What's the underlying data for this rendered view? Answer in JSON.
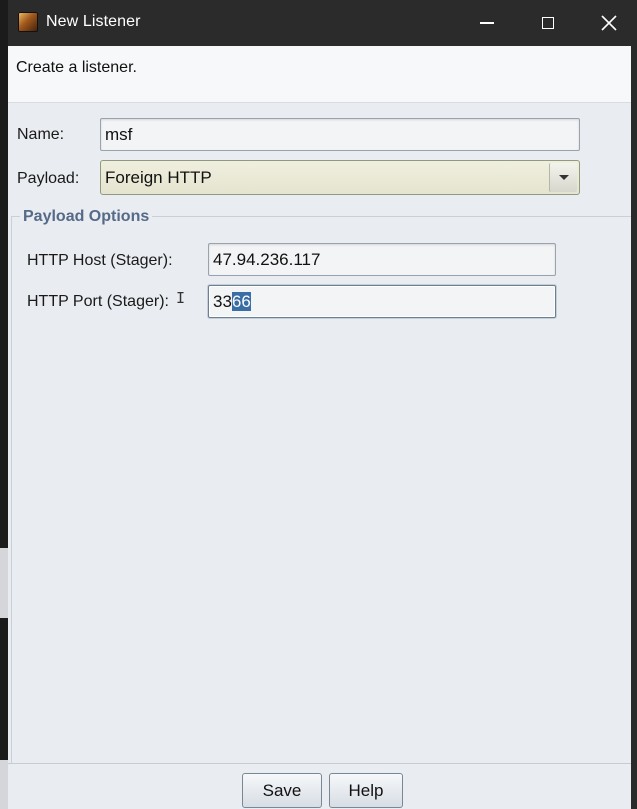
{
  "window": {
    "title": "New Listener",
    "controls": {
      "minimize": "minimize-icon",
      "maximize": "maximize-icon",
      "close": "close-icon"
    }
  },
  "header": {
    "text": "Create a listener."
  },
  "form": {
    "name": {
      "label": "Name:",
      "value": "msf"
    },
    "payload": {
      "label": "Payload:",
      "value": "Foreign HTTP"
    }
  },
  "payload_options": {
    "title": "Payload Options",
    "host": {
      "label": "HTTP Host (Stager):",
      "value": "47.94.236.117"
    },
    "port": {
      "label": "HTTP Port (Stager):",
      "value_plain": "33",
      "value_selected": "66"
    }
  },
  "buttons": {
    "save": "Save",
    "help": "Help"
  },
  "colors": {
    "group_title": "#556a88",
    "selection": "#3b6ea5",
    "dropdown": "#eceadb",
    "titlebar": "#2b2b2b"
  }
}
